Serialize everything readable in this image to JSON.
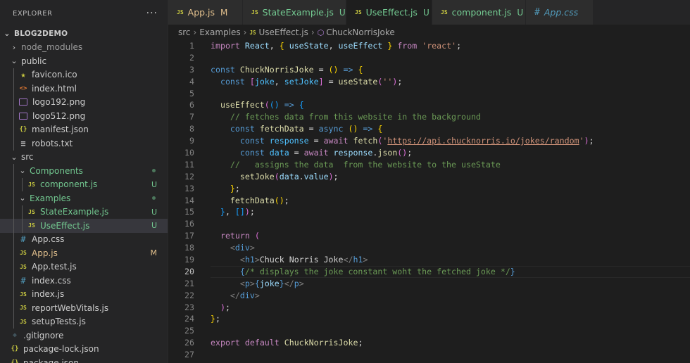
{
  "explorer": {
    "title": "EXPLORER",
    "more": "···",
    "root": "BLOG2DEMO",
    "items": [
      {
        "depth": 0,
        "type": "folder",
        "open": false,
        "label": "node_modules",
        "style": "dim"
      },
      {
        "depth": 0,
        "type": "folder",
        "open": true,
        "label": "public"
      },
      {
        "depth": 1,
        "type": "file",
        "icon": "star",
        "label": "favicon.ico"
      },
      {
        "depth": 1,
        "type": "file",
        "icon": "html",
        "label": "index.html"
      },
      {
        "depth": 1,
        "type": "file",
        "icon": "img",
        "label": "logo192.png"
      },
      {
        "depth": 1,
        "type": "file",
        "icon": "img",
        "label": "logo512.png"
      },
      {
        "depth": 1,
        "type": "file",
        "icon": "json",
        "label": "manifest.json"
      },
      {
        "depth": 1,
        "type": "file",
        "icon": "txt",
        "label": "robots.txt"
      },
      {
        "depth": 0,
        "type": "folder",
        "open": true,
        "label": "src"
      },
      {
        "depth": 1,
        "type": "folder",
        "open": true,
        "label": "Components",
        "status": "dot"
      },
      {
        "depth": 2,
        "type": "file",
        "icon": "js",
        "label": "component.js",
        "status": "U"
      },
      {
        "depth": 1,
        "type": "folder",
        "open": true,
        "label": "Examples",
        "status": "dot"
      },
      {
        "depth": 2,
        "type": "file",
        "icon": "js",
        "label": "StateExample.js",
        "status": "U"
      },
      {
        "depth": 2,
        "type": "file",
        "icon": "js",
        "label": "UseEffect.js",
        "status": "U",
        "selected": true
      },
      {
        "depth": 1,
        "type": "file",
        "icon": "hash",
        "label": "App.css"
      },
      {
        "depth": 1,
        "type": "file",
        "icon": "js",
        "label": "App.js",
        "status": "M"
      },
      {
        "depth": 1,
        "type": "file",
        "icon": "js",
        "label": "App.test.js"
      },
      {
        "depth": 1,
        "type": "file",
        "icon": "hash",
        "label": "index.css"
      },
      {
        "depth": 1,
        "type": "file",
        "icon": "js",
        "label": "index.js"
      },
      {
        "depth": 1,
        "type": "file",
        "icon": "js",
        "label": "reportWebVitals.js"
      },
      {
        "depth": 1,
        "type": "file",
        "icon": "js",
        "label": "setupTests.js"
      },
      {
        "depth": 0,
        "type": "file",
        "icon": "git",
        "label": ".gitignore"
      },
      {
        "depth": 0,
        "type": "file",
        "icon": "json",
        "label": "package-lock.json"
      },
      {
        "depth": 0,
        "type": "file",
        "icon": "json",
        "label": "package.json"
      }
    ]
  },
  "tabs": [
    {
      "label": "App.js",
      "icon": "js",
      "badge": "M",
      "kind": "mod"
    },
    {
      "label": "StateExample.js",
      "icon": "js",
      "badge": "U",
      "kind": "new"
    },
    {
      "label": "UseEffect.js",
      "icon": "js",
      "badge": "U",
      "kind": "new",
      "active": true,
      "close": "✕"
    },
    {
      "label": "component.js",
      "icon": "js",
      "badge": "U",
      "kind": "new"
    },
    {
      "label": "App.css",
      "icon": "hash",
      "badge": "",
      "kind": "css"
    }
  ],
  "breadcrumb": {
    "parts": [
      "src",
      "Examples",
      "UseEffect.js",
      "ChuckNorrisJoke"
    ],
    "sep": "›"
  },
  "editor": {
    "current_line": 20,
    "lines": [
      [
        [
          "t-kw",
          "import"
        ],
        [
          "txt",
          " "
        ],
        [
          "t-var",
          "React"
        ],
        [
          "txt",
          ", "
        ],
        [
          "t-p1",
          "{"
        ],
        [
          "txt",
          " "
        ],
        [
          "t-var",
          "useState"
        ],
        [
          "txt",
          ", "
        ],
        [
          "t-var",
          "useEffect"
        ],
        [
          "txt",
          " "
        ],
        [
          "t-p1",
          "}"
        ],
        [
          "txt",
          " "
        ],
        [
          "t-kw",
          "from"
        ],
        [
          "txt",
          " "
        ],
        [
          "t-str",
          "'react'"
        ],
        [
          "txt",
          ";"
        ]
      ],
      [],
      [
        [
          "t-st",
          "const"
        ],
        [
          "txt",
          " "
        ],
        [
          "t-fn",
          "ChuckNorrisJoke"
        ],
        [
          "txt",
          " = "
        ],
        [
          "t-p1",
          "()"
        ],
        [
          "txt",
          " "
        ],
        [
          "t-st",
          "=>"
        ],
        [
          "txt",
          " "
        ],
        [
          "t-p1",
          "{"
        ]
      ],
      [
        [
          "txt",
          "  "
        ],
        [
          "t-st",
          "const"
        ],
        [
          "txt",
          " "
        ],
        [
          "t-p2",
          "["
        ],
        [
          "t-cn",
          "joke"
        ],
        [
          "txt",
          ", "
        ],
        [
          "t-cn",
          "setJoke"
        ],
        [
          "t-p2",
          "]"
        ],
        [
          "txt",
          " = "
        ],
        [
          "t-fn",
          "useState"
        ],
        [
          "t-p2",
          "("
        ],
        [
          "t-str",
          "''"
        ],
        [
          "t-p2",
          ")"
        ],
        [
          "txt",
          ";"
        ]
      ],
      [],
      [
        [
          "txt",
          "  "
        ],
        [
          "t-fn",
          "useEffect"
        ],
        [
          "t-p2",
          "("
        ],
        [
          "t-p3",
          "()"
        ],
        [
          "txt",
          " "
        ],
        [
          "t-st",
          "=>"
        ],
        [
          "txt",
          " "
        ],
        [
          "t-p3",
          "{"
        ]
      ],
      [
        [
          "txt",
          "    "
        ],
        [
          "t-com",
          "// fetches data from this website in the background"
        ]
      ],
      [
        [
          "txt",
          "    "
        ],
        [
          "t-st",
          "const"
        ],
        [
          "txt",
          " "
        ],
        [
          "t-fn",
          "fetchData"
        ],
        [
          "txt",
          " = "
        ],
        [
          "t-st",
          "async"
        ],
        [
          "txt",
          " "
        ],
        [
          "t-p1",
          "()"
        ],
        [
          "txt",
          " "
        ],
        [
          "t-st",
          "=>"
        ],
        [
          "txt",
          " "
        ],
        [
          "t-p1",
          "{"
        ]
      ],
      [
        [
          "txt",
          "      "
        ],
        [
          "t-st",
          "const"
        ],
        [
          "txt",
          " "
        ],
        [
          "t-cn",
          "response"
        ],
        [
          "txt",
          " = "
        ],
        [
          "t-kw",
          "await"
        ],
        [
          "txt",
          " "
        ],
        [
          "t-fn",
          "fetch"
        ],
        [
          "t-p2",
          "("
        ],
        [
          "t-str",
          "'"
        ],
        [
          "t-url",
          "https://api.chucknorris.io/jokes/random"
        ],
        [
          "t-str",
          "'"
        ],
        [
          "t-p2",
          ")"
        ],
        [
          "txt",
          ";"
        ]
      ],
      [
        [
          "txt",
          "      "
        ],
        [
          "t-st",
          "const"
        ],
        [
          "txt",
          " "
        ],
        [
          "t-cn",
          "data"
        ],
        [
          "txt",
          " = "
        ],
        [
          "t-kw",
          "await"
        ],
        [
          "txt",
          " "
        ],
        [
          "t-var",
          "response"
        ],
        [
          "txt",
          "."
        ],
        [
          "t-fn",
          "json"
        ],
        [
          "t-p2",
          "()"
        ],
        [
          "txt",
          ";"
        ]
      ],
      [
        [
          "txt",
          "    "
        ],
        [
          "t-com",
          "//   assigns the data  from the website to the useState"
        ]
      ],
      [
        [
          "txt",
          "      "
        ],
        [
          "t-fn",
          "setJoke"
        ],
        [
          "t-p2",
          "("
        ],
        [
          "t-var",
          "data"
        ],
        [
          "txt",
          "."
        ],
        [
          "t-var",
          "value"
        ],
        [
          "t-p2",
          ")"
        ],
        [
          "txt",
          ";"
        ]
      ],
      [
        [
          "txt",
          "    "
        ],
        [
          "t-p1",
          "}"
        ],
        [
          "txt",
          ";"
        ]
      ],
      [
        [
          "txt",
          "    "
        ],
        [
          "t-fn",
          "fetchData"
        ],
        [
          "t-p1",
          "()"
        ],
        [
          "txt",
          ";"
        ]
      ],
      [
        [
          "txt",
          "  "
        ],
        [
          "t-p3",
          "}"
        ],
        [
          "txt",
          ", "
        ],
        [
          "t-p3",
          "[]"
        ],
        [
          "t-p2",
          ")"
        ],
        [
          "txt",
          ";"
        ]
      ],
      [],
      [
        [
          "txt",
          "  "
        ],
        [
          "t-kw",
          "return"
        ],
        [
          "txt",
          " "
        ],
        [
          "t-p2",
          "("
        ]
      ],
      [
        [
          "txt",
          "    "
        ],
        [
          "t-br",
          "<"
        ],
        [
          "t-tag",
          "div"
        ],
        [
          "t-br",
          ">"
        ]
      ],
      [
        [
          "txt",
          "      "
        ],
        [
          "t-br",
          "<"
        ],
        [
          "t-tag",
          "h1"
        ],
        [
          "t-br",
          ">"
        ],
        [
          "t-pl",
          "Chuck Norris Joke"
        ],
        [
          "t-br",
          "</"
        ],
        [
          "t-tag",
          "h1"
        ],
        [
          "t-br",
          ">"
        ]
      ],
      [
        [
          "txt",
          "      "
        ],
        [
          "t-st",
          "{"
        ],
        [
          "t-com",
          "/* displays the joke constant woht the fetched joke */"
        ],
        [
          "t-st",
          "}"
        ]
      ],
      [
        [
          "txt",
          "      "
        ],
        [
          "t-br",
          "<"
        ],
        [
          "t-tag",
          "p"
        ],
        [
          "t-br",
          ">"
        ],
        [
          "t-st",
          "{"
        ],
        [
          "t-var",
          "joke"
        ],
        [
          "t-st",
          "}"
        ],
        [
          "t-br",
          "</"
        ],
        [
          "t-tag",
          "p"
        ],
        [
          "t-br",
          ">"
        ]
      ],
      [
        [
          "txt",
          "    "
        ],
        [
          "t-br",
          "</"
        ],
        [
          "t-tag",
          "div"
        ],
        [
          "t-br",
          ">"
        ]
      ],
      [
        [
          "txt",
          "  "
        ],
        [
          "t-p2",
          ")"
        ],
        [
          "txt",
          ";"
        ]
      ],
      [
        [
          "t-p1",
          "}"
        ],
        [
          "txt",
          ";"
        ]
      ],
      [],
      [
        [
          "t-kw",
          "export"
        ],
        [
          "txt",
          " "
        ],
        [
          "t-kw",
          "default"
        ],
        [
          "txt",
          " "
        ],
        [
          "t-fn",
          "ChuckNorrisJoke"
        ],
        [
          "txt",
          ";"
        ]
      ],
      []
    ]
  }
}
